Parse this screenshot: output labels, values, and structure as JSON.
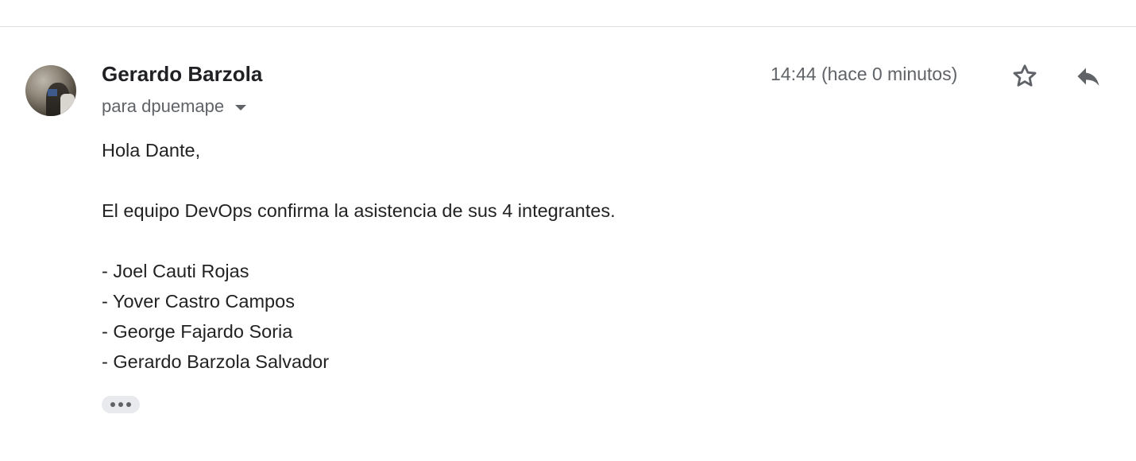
{
  "message": {
    "sender": "Gerardo Barzola",
    "recipient_label": "para dpuemape",
    "timestamp": "14:44 (hace 0 minutos)",
    "body": {
      "greeting": "Hola Dante,",
      "line1": "El equipo DevOps confirma la asistencia de sus 4 integrantes.",
      "members": [
        "- Joel Cauti Rojas",
        "- Yover Castro Campos",
        "- George Fajardo Soria",
        "- Gerardo Barzola Salvador"
      ]
    }
  },
  "icons": {
    "star": "star-outline-icon",
    "reply": "reply-icon",
    "recipient_toggle": "caret-down-icon",
    "show_trimmed": "more-horizontal-icon"
  },
  "colors": {
    "text": "#222222",
    "muted": "#5f6368",
    "divider": "#e0e0e0",
    "chip": "#e8eaed"
  }
}
